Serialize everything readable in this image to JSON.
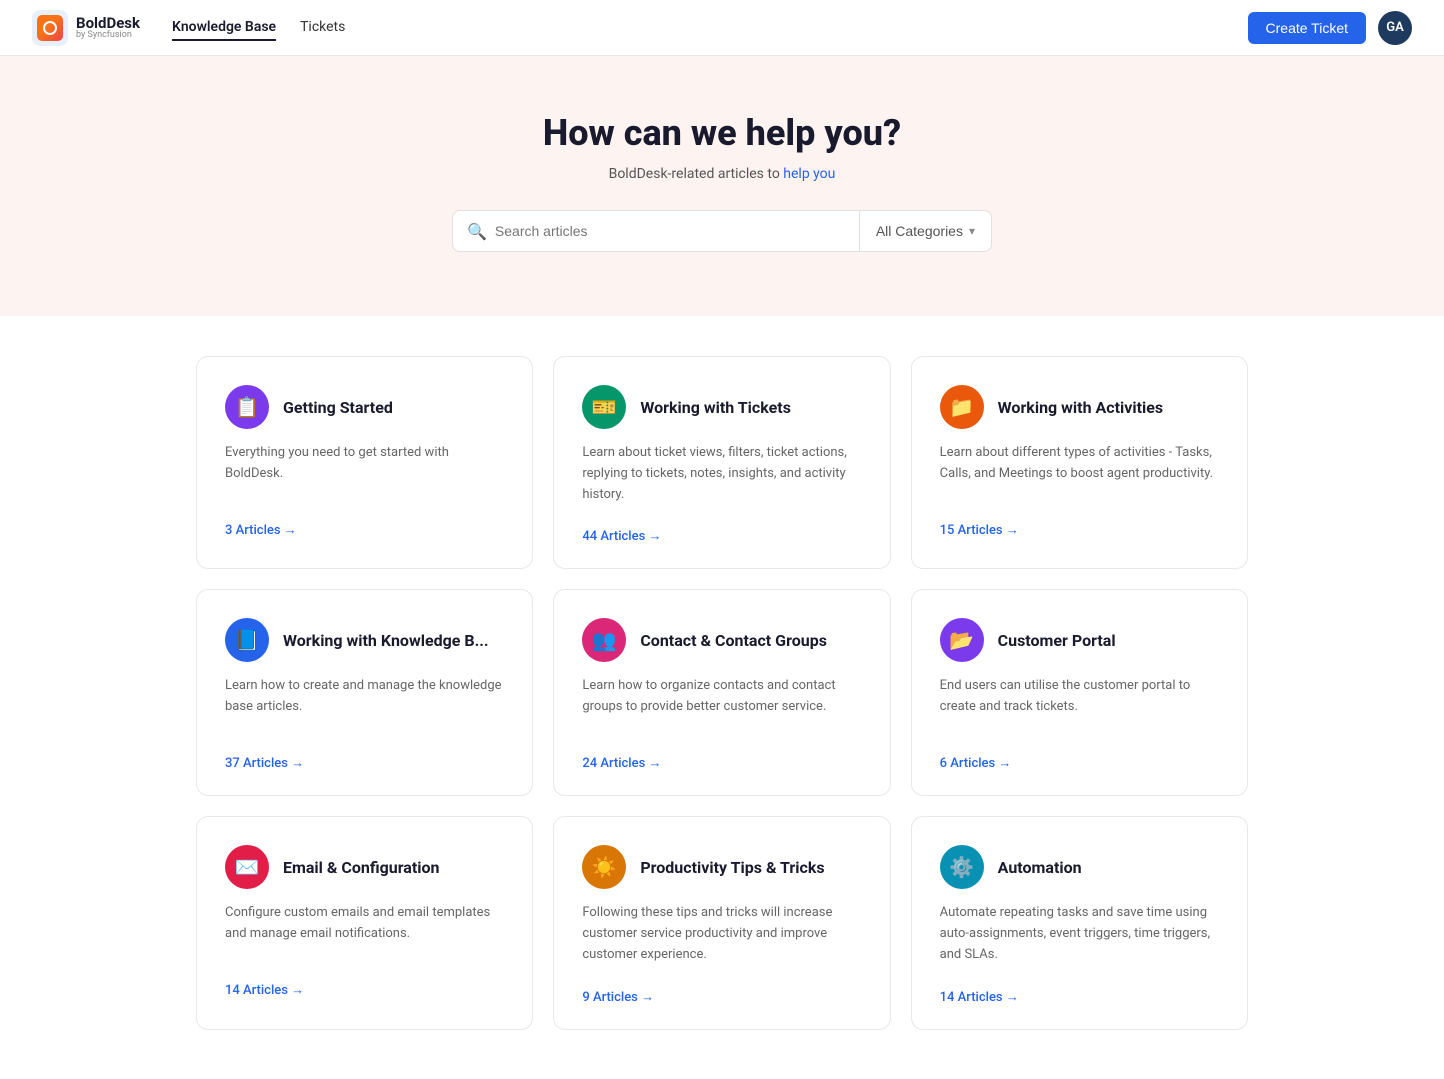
{
  "header": {
    "logo_name": "BoldDesk",
    "logo_sub": "by Syncfusion",
    "nav": [
      {
        "label": "Knowledge Base",
        "active": true
      },
      {
        "label": "Tickets",
        "active": false
      }
    ],
    "create_ticket_label": "Create Ticket",
    "avatar_initials": "GA"
  },
  "hero": {
    "title": "How can we help you?",
    "subtitle_plain": "BoldDesk-related articles to ",
    "subtitle_link": "help you",
    "search_placeholder": "Search articles",
    "category_label": "All Categories"
  },
  "cards": [
    {
      "id": "getting-started",
      "icon": "📋",
      "icon_color": "icon-purple",
      "title": "Getting Started",
      "desc": "Everything you need to get started with BoldDesk.",
      "articles_count": "3 Articles →"
    },
    {
      "id": "working-with-tickets",
      "icon": "🎫",
      "icon_color": "icon-green",
      "title": "Working with Tickets",
      "desc": "Learn about ticket views, filters, ticket actions, replying to tickets, notes, insights, and activity history.",
      "articles_count": "44 Articles →"
    },
    {
      "id": "working-with-activities",
      "icon": "📁",
      "icon_color": "icon-orange",
      "title": "Working with Activities",
      "desc": "Learn about different types of activities - Tasks, Calls, and Meetings to boost agent productivity.",
      "articles_count": "15 Articles →"
    },
    {
      "id": "working-with-knowledge-base",
      "icon": "📘",
      "icon_color": "icon-blue",
      "title": "Working with Knowledge B...",
      "desc": "Learn how to create and manage the knowledge base articles.",
      "articles_count": "37 Articles →"
    },
    {
      "id": "contact-contact-groups",
      "icon": "👥",
      "icon_color": "icon-pink",
      "title": "Contact & Contact Groups",
      "desc": "Learn how to organize contacts and contact groups to provide better customer service.",
      "articles_count": "24 Articles →"
    },
    {
      "id": "customer-portal",
      "icon": "📂",
      "icon_color": "icon-violet",
      "title": "Customer Portal",
      "desc": "End users can utilise the customer portal to create and track tickets.",
      "articles_count": "6 Articles →"
    },
    {
      "id": "email-configuration",
      "icon": "✉️",
      "icon_color": "icon-rose",
      "title": "Email & Configuration",
      "desc": "Configure custom emails and email templates and manage email notifications.",
      "articles_count": "14 Articles →"
    },
    {
      "id": "productivity-tips",
      "icon": "☀️",
      "icon_color": "icon-amber",
      "title": "Productivity Tips & Tricks",
      "desc": "Following these tips and tricks will increase customer service productivity and improve customer experience.",
      "articles_count": "9 Articles →"
    },
    {
      "id": "automation",
      "icon": "⚙️",
      "icon_color": "icon-teal",
      "title": "Automation",
      "desc": "Automate repeating tasks and save time using auto-assignments, event triggers, time triggers, and SLAs.",
      "articles_count": "14 Articles →"
    }
  ]
}
